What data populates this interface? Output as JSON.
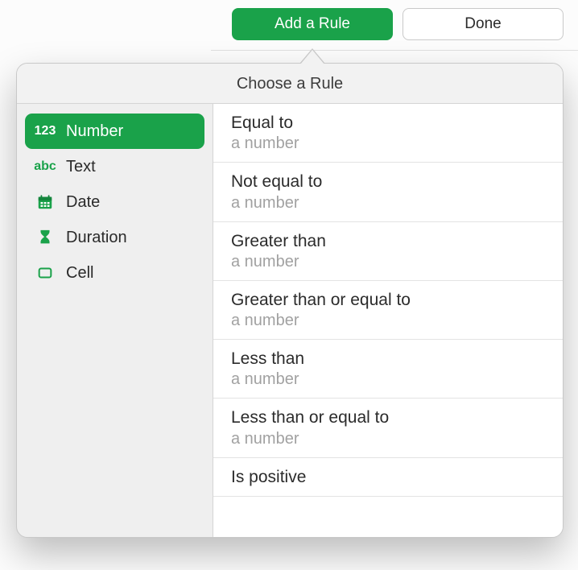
{
  "toolbar": {
    "add_rule_label": "Add a Rule",
    "done_label": "Done"
  },
  "popover": {
    "title": "Choose a Rule"
  },
  "sidebar": {
    "items": [
      {
        "icon_text": "123",
        "label": "Number",
        "selected": true,
        "name": "sidebar-item-number",
        "icon_name": "number-icon"
      },
      {
        "icon_text": "abc",
        "label": "Text",
        "selected": false,
        "name": "sidebar-item-text",
        "icon_name": "text-icon"
      },
      {
        "icon_svg": "calendar",
        "label": "Date",
        "selected": false,
        "name": "sidebar-item-date",
        "icon_name": "calendar-icon"
      },
      {
        "icon_svg": "hourglass",
        "label": "Duration",
        "selected": false,
        "name": "sidebar-item-duration",
        "icon_name": "hourglass-icon"
      },
      {
        "icon_svg": "cell",
        "label": "Cell",
        "selected": false,
        "name": "sidebar-item-cell",
        "icon_name": "cell-icon"
      }
    ]
  },
  "rules": [
    {
      "title": "Equal to",
      "sub": "a number"
    },
    {
      "title": "Not equal to",
      "sub": "a number"
    },
    {
      "title": "Greater than",
      "sub": "a number"
    },
    {
      "title": "Greater than or equal to",
      "sub": "a number"
    },
    {
      "title": "Less than",
      "sub": "a number"
    },
    {
      "title": "Less than or equal to",
      "sub": "a number"
    },
    {
      "title": "Is positive",
      "sub": ""
    }
  ],
  "colors": {
    "accent": "#1aa24a"
  }
}
